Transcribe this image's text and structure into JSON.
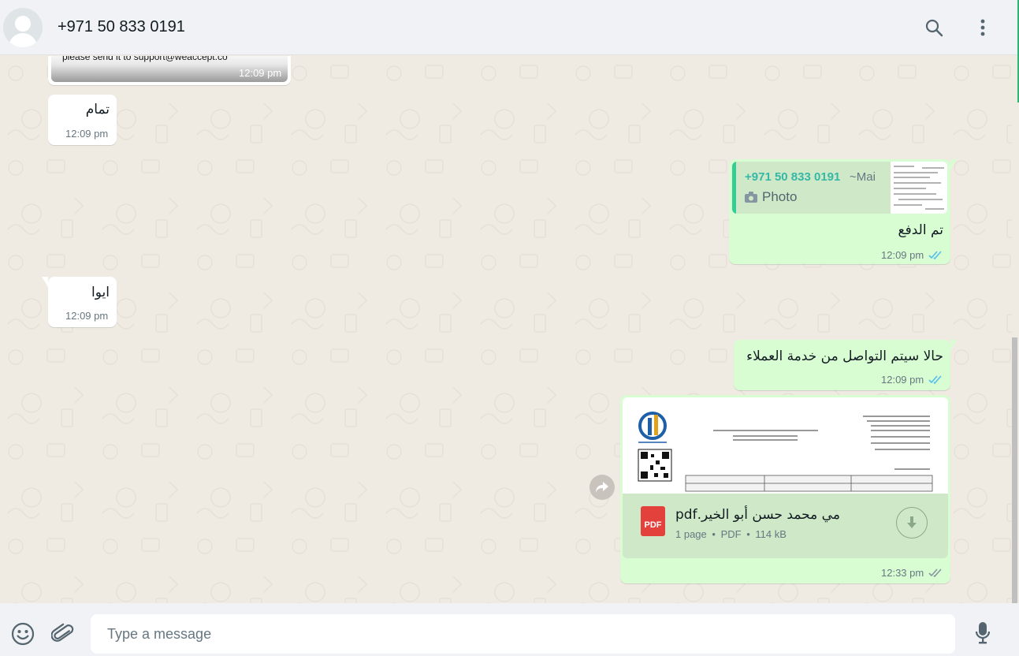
{
  "header": {
    "contact_name": "+971 50 833 0191",
    "icons": [
      "avatar",
      "search-icon",
      "menu-icon"
    ]
  },
  "messages": [
    {
      "id": "m0",
      "direction": "incoming",
      "type": "image-caption",
      "text": "please send it to support@weaccept.co",
      "time": "12:09 pm"
    },
    {
      "id": "m1",
      "direction": "incoming",
      "type": "text",
      "text": "تمام",
      "time": "12:09 pm"
    },
    {
      "id": "m2",
      "direction": "outgoing",
      "type": "reply",
      "quote_author": "+971 50 833 0191",
      "quote_name": "~Mai",
      "quote_text": "Photo",
      "text": "تم الدفع",
      "time": "12:09 pm",
      "status": "read"
    },
    {
      "id": "m3",
      "direction": "incoming",
      "type": "text",
      "text": "ايوا",
      "time": "12:09 pm"
    },
    {
      "id": "m4",
      "direction": "outgoing",
      "type": "text",
      "text": "حالا سيتم التواصل من خدمة العملاء",
      "time": "12:09 pm",
      "status": "read"
    },
    {
      "id": "m5",
      "direction": "outgoing",
      "type": "document",
      "file_name": "مي محمد حسن أبو الخير.pdf",
      "file_badge": "PDF",
      "pages": "1 page",
      "file_type": "PDF",
      "file_size": "114 kB",
      "time": "12:33 pm",
      "status": "delivered"
    }
  ],
  "composer": {
    "placeholder": "Type a message"
  },
  "colors": {
    "incoming_bubble": "#ffffff",
    "outgoing_bubble": "#d9fdd3",
    "read_ticks": "#53bdeb",
    "delivered_ticks": "#8696a0",
    "quote_accent": "#35cd96",
    "pdf_red": "#e2413c"
  }
}
